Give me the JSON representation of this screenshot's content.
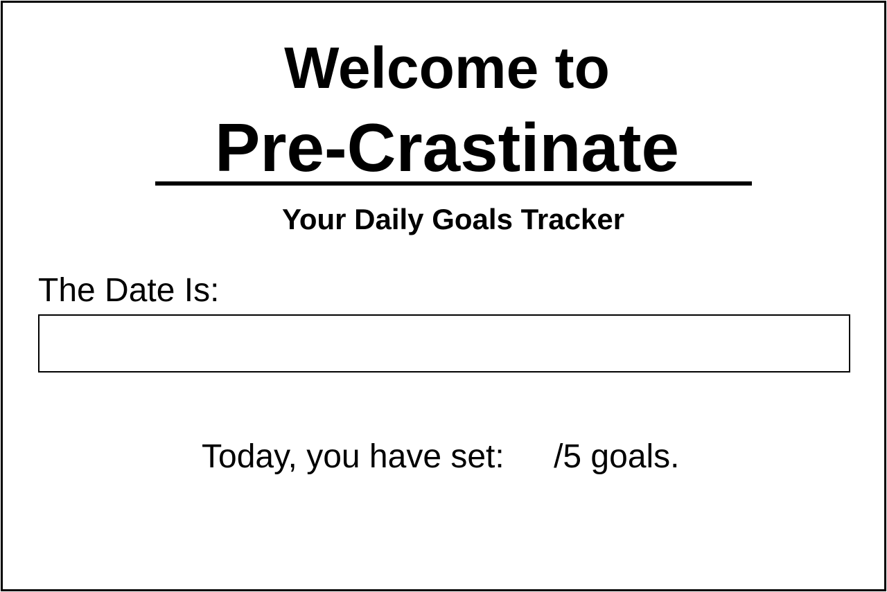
{
  "header": {
    "welcome": "Welcome to",
    "app_name": "Pre-Crastinate",
    "subtitle": "Your Daily Goals Tracker"
  },
  "date": {
    "label": "The Date Is:",
    "value": ""
  },
  "goals": {
    "prefix": "Today, you have set:",
    "count": "",
    "suffix": "/5 goals."
  }
}
